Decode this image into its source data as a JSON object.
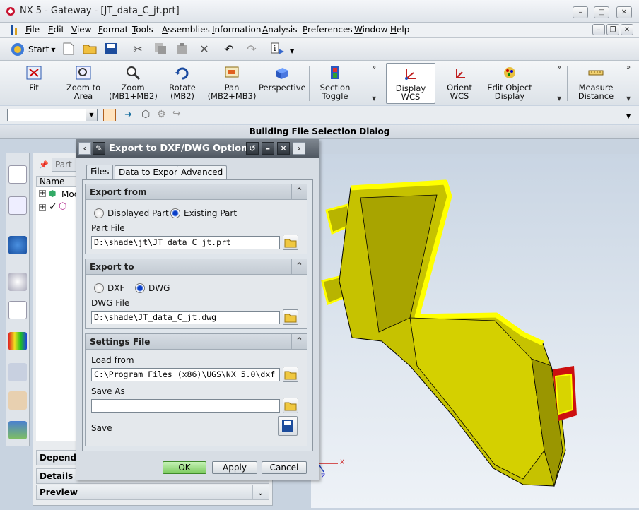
{
  "window": {
    "title": "NX 5 - Gateway - [JT_data_C_jt.prt]"
  },
  "menu": [
    "File",
    "Edit",
    "View",
    "Format",
    "Tools",
    "Assemblies",
    "Information",
    "Analysis",
    "Preferences",
    "Window",
    "Help"
  ],
  "standard_toolbar": {
    "start_label": "Start"
  },
  "view_toolbar": [
    {
      "label": "Fit",
      "icon": "fit-icon"
    },
    {
      "label": "Zoom to\nArea",
      "icon": "zoom-area-icon"
    },
    {
      "label": "Zoom\n(MB1+MB2)",
      "icon": "zoom-icon"
    },
    {
      "label": "Rotate\n(MB2)",
      "icon": "rotate-icon"
    },
    {
      "label": "Pan\n(MB2+MB3)",
      "icon": "pan-icon"
    },
    {
      "label": "Perspective",
      "icon": "perspective-icon"
    },
    {
      "label": "Section\nToggle",
      "icon": "section-icon"
    },
    {
      "label": "Display\nWCS",
      "icon": "wcs-icon"
    },
    {
      "label": "Orient WCS",
      "icon": "orient-wcs-icon"
    },
    {
      "label": "Edit Object\nDisplay",
      "icon": "edit-display-icon"
    },
    {
      "label": "Measure\nDistance",
      "icon": "measure-icon"
    }
  ],
  "cue_line": "Building File Selection Dialog",
  "navigator": {
    "part_tab": "Part",
    "column_name": "Name",
    "node_1": "Mod",
    "panels": [
      "Depende",
      "Details",
      "Preview"
    ]
  },
  "dialog": {
    "title": "Export to DXF/DWG Options",
    "tabs": [
      "Files",
      "Data to Export",
      "Advanced"
    ],
    "export_from": {
      "header": "Export from",
      "option_displayed": "Displayed Part",
      "option_existing": "Existing Part",
      "selected": "Existing Part",
      "field_label": "Part File",
      "field_value": "D:\\shade\\jt\\JT_data_C_jt.prt"
    },
    "export_to": {
      "header": "Export to",
      "option_dxf": "DXF",
      "option_dwg": "DWG",
      "selected": "DWG",
      "field_label": "DWG File",
      "field_value": "D:\\shade\\JT_data_C_jt.dwg"
    },
    "settings": {
      "header": "Settings File",
      "load_label": "Load from",
      "load_value": "C:\\Program Files (x86)\\UGS\\NX 5.0\\dxf",
      "save_as_label": "Save As",
      "save_as_value": "",
      "save_label": "Save"
    },
    "buttons": {
      "ok": "OK",
      "apply": "Apply",
      "cancel": "Cancel"
    }
  },
  "triad": {
    "x": "X",
    "z": "Z"
  },
  "colors": {
    "model_face": "#c6c200",
    "model_edge": "#ffff00",
    "accent_red": "#cc1010"
  }
}
